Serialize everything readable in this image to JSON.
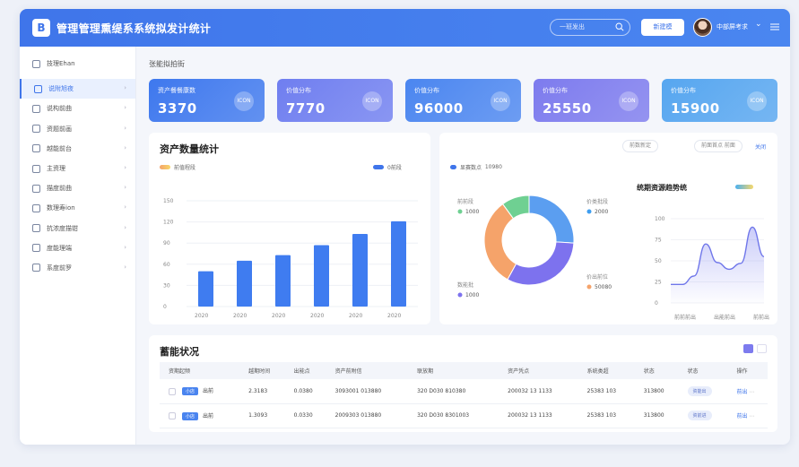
{
  "header": {
    "logo_letter": "B",
    "title": "管理管理熏缇系系统拟发计统计",
    "search_placeholder": "一班发出",
    "button_label": "新建模",
    "user_name": "中部屏考求"
  },
  "sidebar": {
    "head": "技理Ehan",
    "items": [
      {
        "label": "说附旭夜",
        "active": true
      },
      {
        "label": "说构前曲",
        "active": false
      },
      {
        "label": "资题前画",
        "active": false
      },
      {
        "label": "越能前台",
        "active": false
      },
      {
        "label": "主资理",
        "active": false
      },
      {
        "label": "描度前曲",
        "active": false
      },
      {
        "label": "数理寿ion",
        "active": false
      },
      {
        "label": "抗浓度描钳",
        "active": false
      },
      {
        "label": "度能理端",
        "active": false
      },
      {
        "label": "系度前罗",
        "active": false
      }
    ]
  },
  "breadcrumb": "张能拟拍街",
  "cards": [
    {
      "label": "资产餐餐康数",
      "value": "3370",
      "icon": "ICON",
      "color": "#3e78ee"
    },
    {
      "label": "价值分布",
      "value": "7770",
      "icon": "ICON",
      "color": "#6f7ef0"
    },
    {
      "label": "价值分布",
      "value": "96000",
      "icon": "ICON",
      "color": "#4b86f0"
    },
    {
      "label": "价值分布",
      "value": "25550",
      "icon": "ICON",
      "color": "#7d7bee"
    },
    {
      "label": "价值分布",
      "value": "15900",
      "icon": "ICON",
      "color": "#56a6f0"
    }
  ],
  "colors": {
    "accent": "#3f75ea",
    "donut": [
      "#5b9ef0",
      "#7d72ee",
      "#f5a36a",
      "#6fd092"
    ]
  },
  "bar_panel": {
    "title": "资产数量统计",
    "legend_left": "前值程段",
    "legend_right": "0前段"
  },
  "donut_panel": {
    "legend": "显赛数点",
    "legend_value": "10980",
    "labels": [
      {
        "name": "前前段",
        "value": "1000"
      },
      {
        "name": "价类批段",
        "value": "2000"
      },
      {
        "name": "价出前位",
        "value": "50080"
      },
      {
        "name": "数能批",
        "value": "1000"
      }
    ],
    "chips": [
      "前数新定",
      "前面首点 前面"
    ],
    "chip_link": "关闭"
  },
  "line_panel": {
    "title": "统期资源趋势统"
  },
  "table": {
    "title": "蓄能状况",
    "headers": [
      "资期起频",
      "越期时间",
      "出能点",
      "资产前附信",
      "联放期",
      "资产凭点",
      "系统类超",
      "状态",
      "状态",
      "操作"
    ],
    "rows": [
      {
        "tag": "小店",
        "c1": "出前",
        "c2": "2.3183",
        "c3": "0.0380",
        "c4": "3093001 013880",
        "c5": "320 D030 810380",
        "c6": "200032 13 1133",
        "c7": "25383 103",
        "c8": "313800",
        "status": "资能出",
        "op": "前出"
      },
      {
        "tag": "小店",
        "c1": "出前",
        "c2": "1.3093",
        "c3": "0.0330",
        "c4": "2009303 013880",
        "c5": "320 D030 8301003",
        "c6": "200032 13 1133",
        "c7": "25383 103",
        "c8": "313800",
        "status": "资前进",
        "op": "前出"
      }
    ]
  },
  "chart_data": [
    {
      "type": "bar",
      "title": "资产数量统计",
      "categories": [
        "2020",
        "2020",
        "2020",
        "2020",
        "2020",
        "2020"
      ],
      "values": [
        50,
        65,
        73,
        87,
        103,
        121
      ],
      "y_ticks": [
        "150",
        "120",
        "90",
        "60",
        "30",
        "0"
      ],
      "ylim": [
        0,
        150
      ]
    },
    {
      "type": "pie",
      "slices": [
        {
          "name": "前前段",
          "value": 26
        },
        {
          "name": "价出前位",
          "value": 32
        },
        {
          "name": "价类批段",
          "value": 32
        },
        {
          "name": "数能批",
          "value": 10
        }
      ]
    },
    {
      "type": "line",
      "title": "统期资源趋势统",
      "categories": [
        "前前前出",
        "出能前出",
        "前前出"
      ],
      "values": [
        22,
        22,
        32,
        70,
        48,
        40,
        47,
        90,
        55
      ],
      "y_ticks": [
        "100",
        "75",
        "50",
        "25",
        "0"
      ],
      "ylim": [
        0,
        100
      ]
    }
  ]
}
